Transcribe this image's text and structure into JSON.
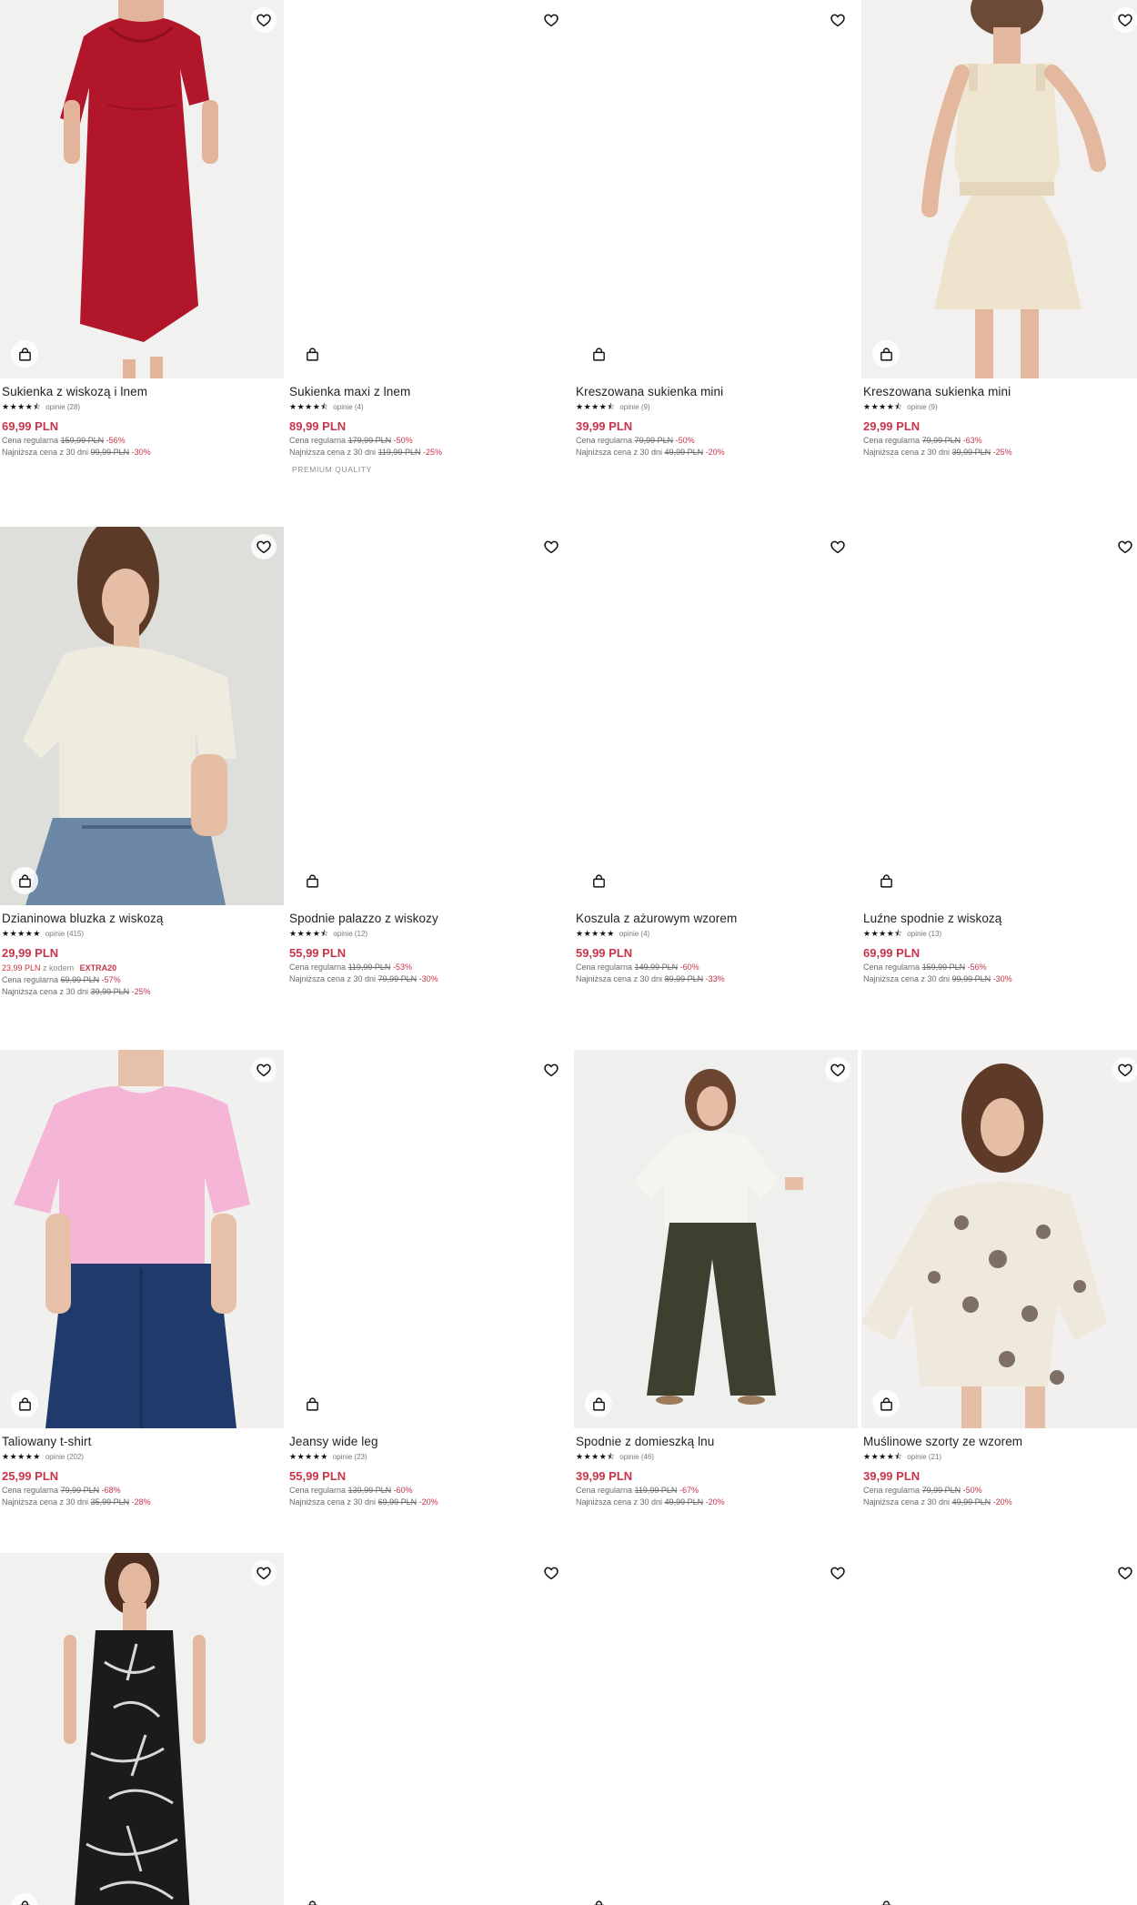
{
  "labels": {
    "regular": "Cena regularna",
    "lowest": "Najniższa cena z 30 dni",
    "reviews_prefix": "opinie",
    "with_code": "z kodem"
  },
  "colors": {
    "price": "#c8344a",
    "text": "#222222"
  },
  "products": [
    {
      "name": "Sukienka z wiskozą i lnem",
      "stars": "★★★★⯪",
      "reviews": "opinie (28)",
      "price": "69,99 PLN",
      "regular_price": "159,99 PLN",
      "regular_discount": "-56%",
      "lowest_price": "99,99 PLN",
      "lowest_discount": "-30%",
      "image": "red-midi-dress",
      "fav_icon": "heart-icon",
      "bag_icon": "bag-icon"
    },
    {
      "name": "Sukienka maxi z lnem",
      "stars": "★★★★⯪",
      "reviews": "opinie (4)",
      "price": "89,99 PLN",
      "regular_price": "179,99 PLN",
      "regular_discount": "-50%",
      "lowest_price": "119,99 PLN",
      "lowest_discount": "-25%",
      "badge": "PREMIUM QUALITY",
      "image": "",
      "fav_icon": "heart-icon",
      "bag_icon": "bag-icon"
    },
    {
      "name": "Kreszowana sukienka mini",
      "stars": "★★★★⯪",
      "reviews": "opinie (9)",
      "price": "39,99 PLN",
      "regular_price": "79,99 PLN",
      "regular_discount": "-50%",
      "lowest_price": "49,99 PLN",
      "lowest_discount": "-20%",
      "image": "",
      "fav_icon": "heart-icon",
      "bag_icon": "bag-icon"
    },
    {
      "name": "Kreszowana sukienka mini",
      "stars": "★★★★⯪",
      "reviews": "opinie (9)",
      "price": "29,99 PLN",
      "regular_price": "79,99 PLN",
      "regular_discount": "-63%",
      "lowest_price": "39,99 PLN",
      "lowest_discount": "-25%",
      "image": "cream-mini-dress",
      "fav_icon": "heart-icon",
      "bag_icon": "bag-icon"
    },
    {
      "name": "Dzianinowa bluzka z wiskozą",
      "stars": "★★★★★",
      "reviews": "opinie (415)",
      "price": "29,99 PLN",
      "promo_price": "23,99 PLN",
      "promo_code": "EXTRA20",
      "regular_price": "69,99 PLN",
      "regular_discount": "-57%",
      "lowest_price": "39,99 PLN",
      "lowest_discount": "-25%",
      "image": "cream-knit-top",
      "fav_icon": "heart-icon",
      "bag_icon": "bag-icon"
    },
    {
      "name": "Spodnie palazzo z wiskozy",
      "stars": "★★★★⯪",
      "reviews": "opinie (12)",
      "price": "55,99 PLN",
      "regular_price": "119,99 PLN",
      "regular_discount": "-53%",
      "lowest_price": "79,99 PLN",
      "lowest_discount": "-30%",
      "image": "",
      "fav_icon": "heart-icon",
      "bag_icon": "bag-icon"
    },
    {
      "name": "Koszula z ażurowym wzorem",
      "stars": "★★★★★",
      "reviews": "opinie (4)",
      "price": "59,99 PLN",
      "regular_price": "149,99 PLN",
      "regular_discount": "-60%",
      "lowest_price": "89,99 PLN",
      "lowest_discount": "-33%",
      "image": "",
      "fav_icon": "heart-icon",
      "bag_icon": "bag-icon"
    },
    {
      "name": "Luźne spodnie z wiskozą",
      "stars": "★★★★⯪",
      "reviews": "opinie (13)",
      "price": "69,99 PLN",
      "regular_price": "159,99 PLN",
      "regular_discount": "-56%",
      "lowest_price": "99,99 PLN",
      "lowest_discount": "-30%",
      "image": "",
      "fav_icon": "heart-icon",
      "bag_icon": "bag-icon"
    },
    {
      "name": "Taliowany t-shirt",
      "stars": "★★★★★",
      "reviews": "opinie (202)",
      "price": "25,99 PLN",
      "regular_price": "79,99 PLN",
      "regular_discount": "-68%",
      "lowest_price": "35,99 PLN",
      "lowest_discount": "-28%",
      "image": "pink-tshirt",
      "fav_icon": "heart-icon",
      "bag_icon": "bag-icon"
    },
    {
      "name": "Jeansy wide leg",
      "stars": "★★★★★",
      "reviews": "opinie (23)",
      "price": "55,99 PLN",
      "regular_price": "139,99 PLN",
      "regular_discount": "-60%",
      "lowest_price": "69,99 PLN",
      "lowest_discount": "-20%",
      "image": "",
      "fav_icon": "heart-icon",
      "bag_icon": "bag-icon"
    },
    {
      "name": "Spodnie z domieszką lnu",
      "stars": "★★★★⯪",
      "reviews": "opinie (46)",
      "price": "39,99 PLN",
      "regular_price": "119,99 PLN",
      "regular_discount": "-67%",
      "lowest_price": "49,99 PLN",
      "lowest_discount": "-20%",
      "image": "olive-wide-trousers",
      "fav_icon": "heart-icon",
      "bag_icon": "bag-icon"
    },
    {
      "name": "Muślinowe szorty ze wzorem",
      "stars": "★★★★⯪",
      "reviews": "opinie (21)",
      "price": "39,99 PLN",
      "regular_price": "79,99 PLN",
      "regular_discount": "-50%",
      "lowest_price": "49,99 PLN",
      "lowest_discount": "-20%",
      "image": "floral-muslin-set",
      "fav_icon": "heart-icon",
      "bag_icon": "bag-icon"
    },
    {
      "name": "",
      "image": "black-palm-print-dress",
      "fav_icon": "heart-icon",
      "bag_icon": "bag-icon"
    },
    {
      "name": "",
      "image": "",
      "fav_icon": "heart-icon",
      "bag_icon": "bag-icon"
    },
    {
      "name": "",
      "image": "",
      "fav_icon": "heart-icon",
      "bag_icon": "bag-icon"
    },
    {
      "name": "",
      "image": "",
      "fav_icon": "heart-icon",
      "bag_icon": "bag-icon"
    }
  ]
}
